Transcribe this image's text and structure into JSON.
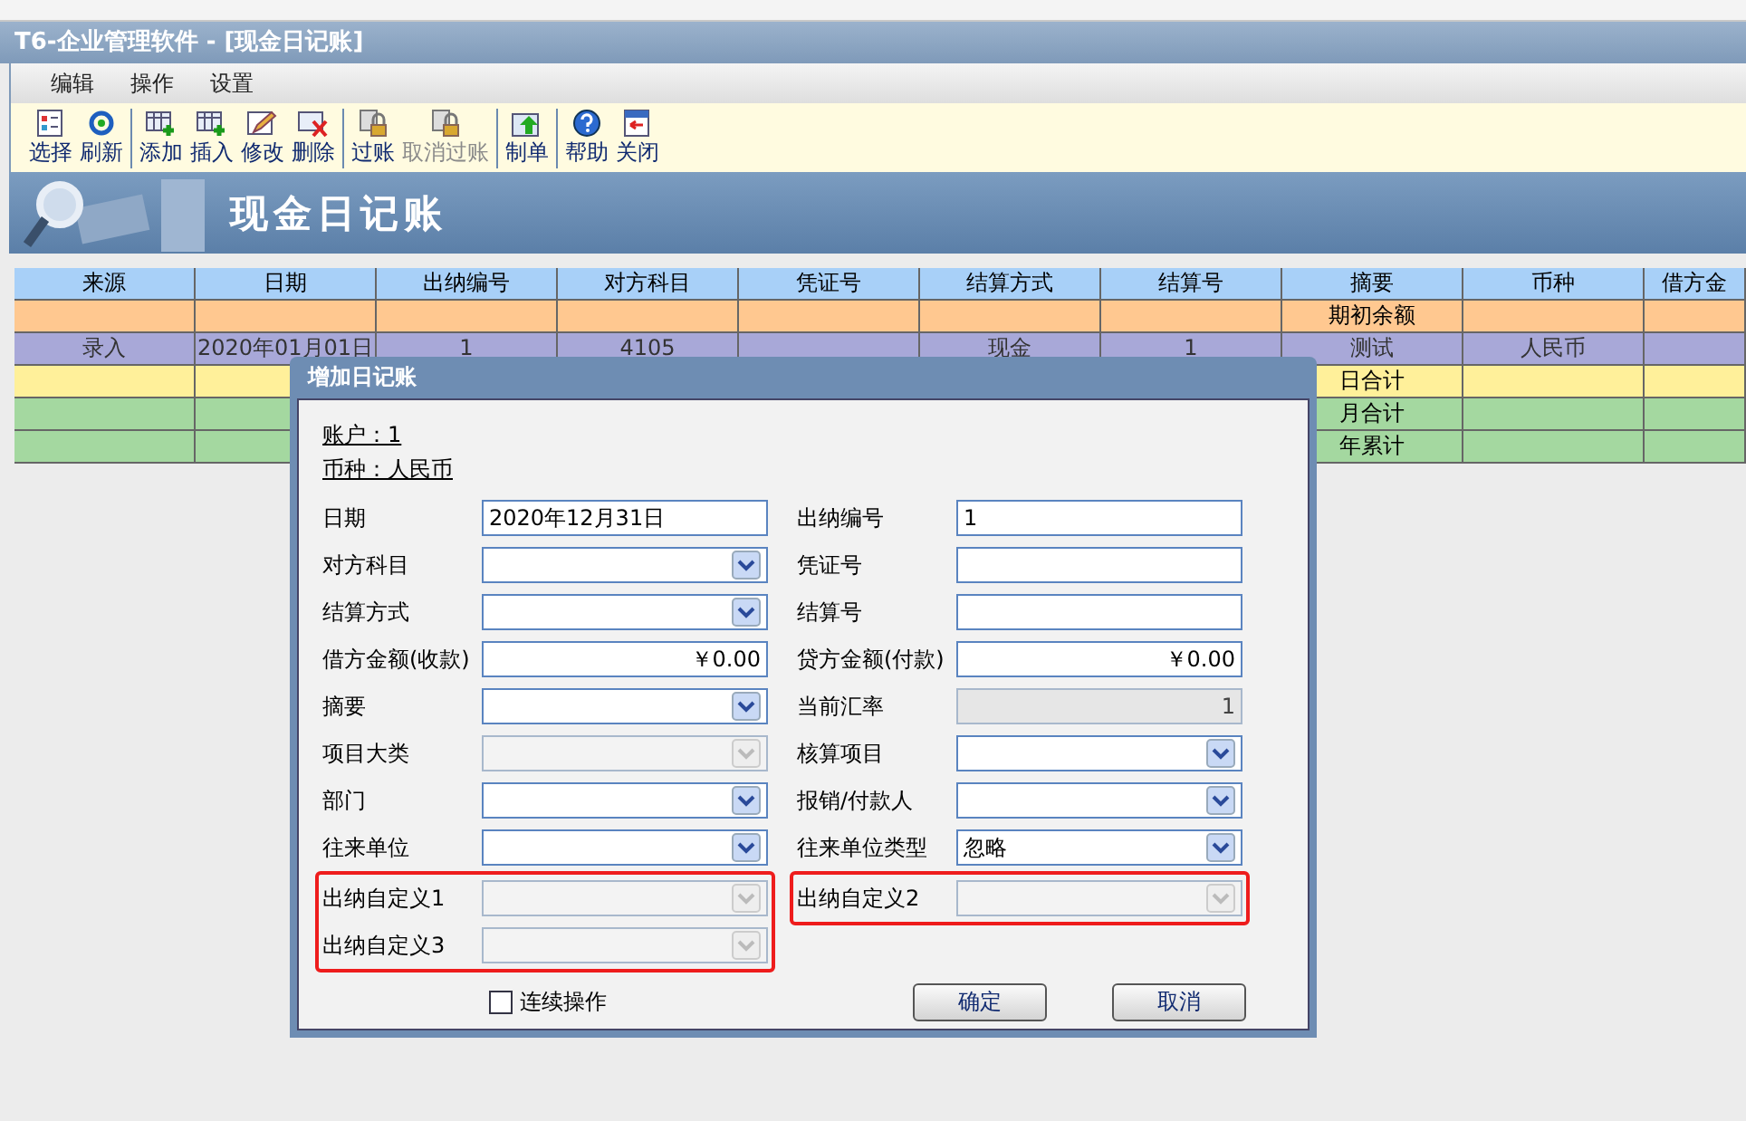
{
  "window": {
    "title": "T6-企业管理软件 - [现金日记账]"
  },
  "menu": [
    "编辑",
    "操作",
    "设置"
  ],
  "toolbar": [
    [
      {
        "label": "选择",
        "disabled": false
      },
      {
        "label": "刷新",
        "disabled": false
      }
    ],
    [
      {
        "label": "添加",
        "disabled": false
      },
      {
        "label": "插入",
        "disabled": false
      },
      {
        "label": "修改",
        "disabled": false
      },
      {
        "label": "删除",
        "disabled": false
      }
    ],
    [
      {
        "label": "过账",
        "disabled": false
      },
      {
        "label": "取消过账",
        "disabled": true
      }
    ],
    [
      {
        "label": "制单",
        "disabled": false
      }
    ],
    [
      {
        "label": "帮助",
        "disabled": false
      },
      {
        "label": "关闭",
        "disabled": false
      }
    ]
  ],
  "banner": {
    "title": "现金日记账"
  },
  "table": {
    "columns": [
      "来源",
      "日期",
      "出纳编号",
      "对方科目",
      "凭证号",
      "结算方式",
      "结算号",
      "摘要",
      "币种",
      "借方金"
    ],
    "rows": [
      {
        "kind": "opening",
        "cells": [
          "",
          "",
          "",
          "",
          "",
          "",
          "",
          "期初余额",
          "",
          ""
        ]
      },
      {
        "kind": "entry",
        "cells": [
          "录入",
          "2020年01月01日",
          "1",
          "4105",
          "",
          "现金",
          "1",
          "测试",
          "人民币",
          ""
        ]
      },
      {
        "kind": "day",
        "cells": [
          "",
          "",
          "",
          "",
          "",
          "",
          "",
          "日合计",
          "",
          ""
        ]
      },
      {
        "kind": "month",
        "cells": [
          "",
          "",
          "",
          "",
          "",
          "",
          "",
          "月合计",
          "",
          ""
        ]
      },
      {
        "kind": "year",
        "cells": [
          "",
          "",
          "",
          "",
          "",
          "",
          "",
          "年累计",
          "",
          ""
        ]
      }
    ]
  },
  "dialog": {
    "title": "增加日记账",
    "account": "账户：1",
    "currency": "币种：人民币",
    "left_fields": [
      {
        "label": "日期",
        "kind": "text",
        "value": "2020年12月31日",
        "disabled": false,
        "highlighted": false
      },
      {
        "label": "对方科目",
        "kind": "combo",
        "disabled": false,
        "highlighted": false
      },
      {
        "label": "结算方式",
        "kind": "combo",
        "disabled": false,
        "highlighted": false
      },
      {
        "label": "借方金额(收款)",
        "kind": "money",
        "value": "￥0.00",
        "disabled": false,
        "highlighted": false
      },
      {
        "label": "摘要",
        "kind": "combo",
        "disabled": false,
        "highlighted": false
      },
      {
        "label": "项目大类",
        "kind": "combo",
        "disabled": true,
        "highlighted": false
      },
      {
        "label": "部门",
        "kind": "combo",
        "disabled": false,
        "highlighted": false
      },
      {
        "label": "往来单位",
        "kind": "combo",
        "disabled": false,
        "highlighted": false
      },
      {
        "label": "出纳自定义1",
        "kind": "combo",
        "disabled": true,
        "highlighted": true
      },
      {
        "label": "出纳自定义3",
        "kind": "combo",
        "disabled": true,
        "highlighted": true
      }
    ],
    "right_fields": [
      {
        "label": "出纳编号",
        "kind": "text",
        "value": "1",
        "disabled": false,
        "highlighted": false
      },
      {
        "label": "凭证号",
        "kind": "text",
        "disabled": false,
        "highlighted": false
      },
      {
        "label": "结算号",
        "kind": "text",
        "disabled": false,
        "highlighted": false
      },
      {
        "label": "贷方金额(付款)",
        "kind": "money",
        "value": "￥0.00",
        "disabled": false,
        "highlighted": false
      },
      {
        "label": "当前汇率",
        "kind": "money",
        "value": "1",
        "disabled": true,
        "highlighted": false
      },
      {
        "label": "核算项目",
        "kind": "combo",
        "disabled": false,
        "highlighted": false
      },
      {
        "label": "报销/付款人",
        "kind": "combo",
        "disabled": false,
        "highlighted": false
      },
      {
        "label": "往来单位类型",
        "kind": "combo",
        "value": "忽略",
        "disabled": false,
        "highlighted": false
      },
      {
        "label": "出纳自定义2",
        "kind": "combo",
        "disabled": true,
        "highlighted": true
      }
    ],
    "continuous": {
      "label": "连续操作",
      "checked": false
    },
    "buttons": [
      "确定",
      "取消"
    ]
  }
}
